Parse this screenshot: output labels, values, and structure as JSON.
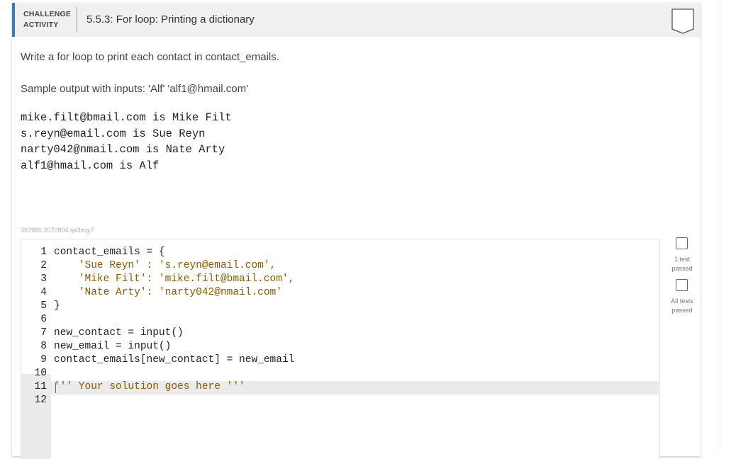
{
  "header": {
    "label_line1": "CHALLENGE",
    "label_line2": "ACTIVITY",
    "title": "5.5.3: For loop: Printing a dictionary"
  },
  "prompt": "Write a for loop to print each contact in contact_emails.",
  "sample_output_label": "Sample output with inputs: 'Alf' 'alf1@hmail.com'",
  "sample_output_lines": [
    "mike.filt@bmail.com is Mike Filt",
    "s.reyn@email.com is Sue Reyn",
    "narty042@nmail.com is Nate Arty",
    "alf1@hmail.com is Alf"
  ],
  "code_id": "397980.2070904.qx3zqy7",
  "editor": {
    "line_numbers": [
      "1",
      "2",
      "3",
      "4",
      "5",
      "6",
      "7",
      "8",
      "9",
      "10",
      "11",
      "12"
    ],
    "lines": [
      "contact_emails = {",
      "    'Sue Reyn' : 's.reyn@email.com',",
      "    'Mike Filt': 'mike.filt@bmail.com',",
      "    'Nate Arty': 'narty042@nmail.com'",
      "}",
      "",
      "new_contact = input()",
      "new_email = input()",
      "contact_emails[new_contact] = new_email",
      "",
      "''' Your solution goes here '''",
      ""
    ]
  },
  "tests": {
    "first_line1": "1 test",
    "first_line2": "passed",
    "all_line1": "All tests",
    "all_line2": "passed"
  },
  "colors": {
    "accent": "#3a7bc8",
    "header_bg": "#f0f0f0",
    "string": "#8a5a00",
    "keyword": "#1a6a8a"
  }
}
